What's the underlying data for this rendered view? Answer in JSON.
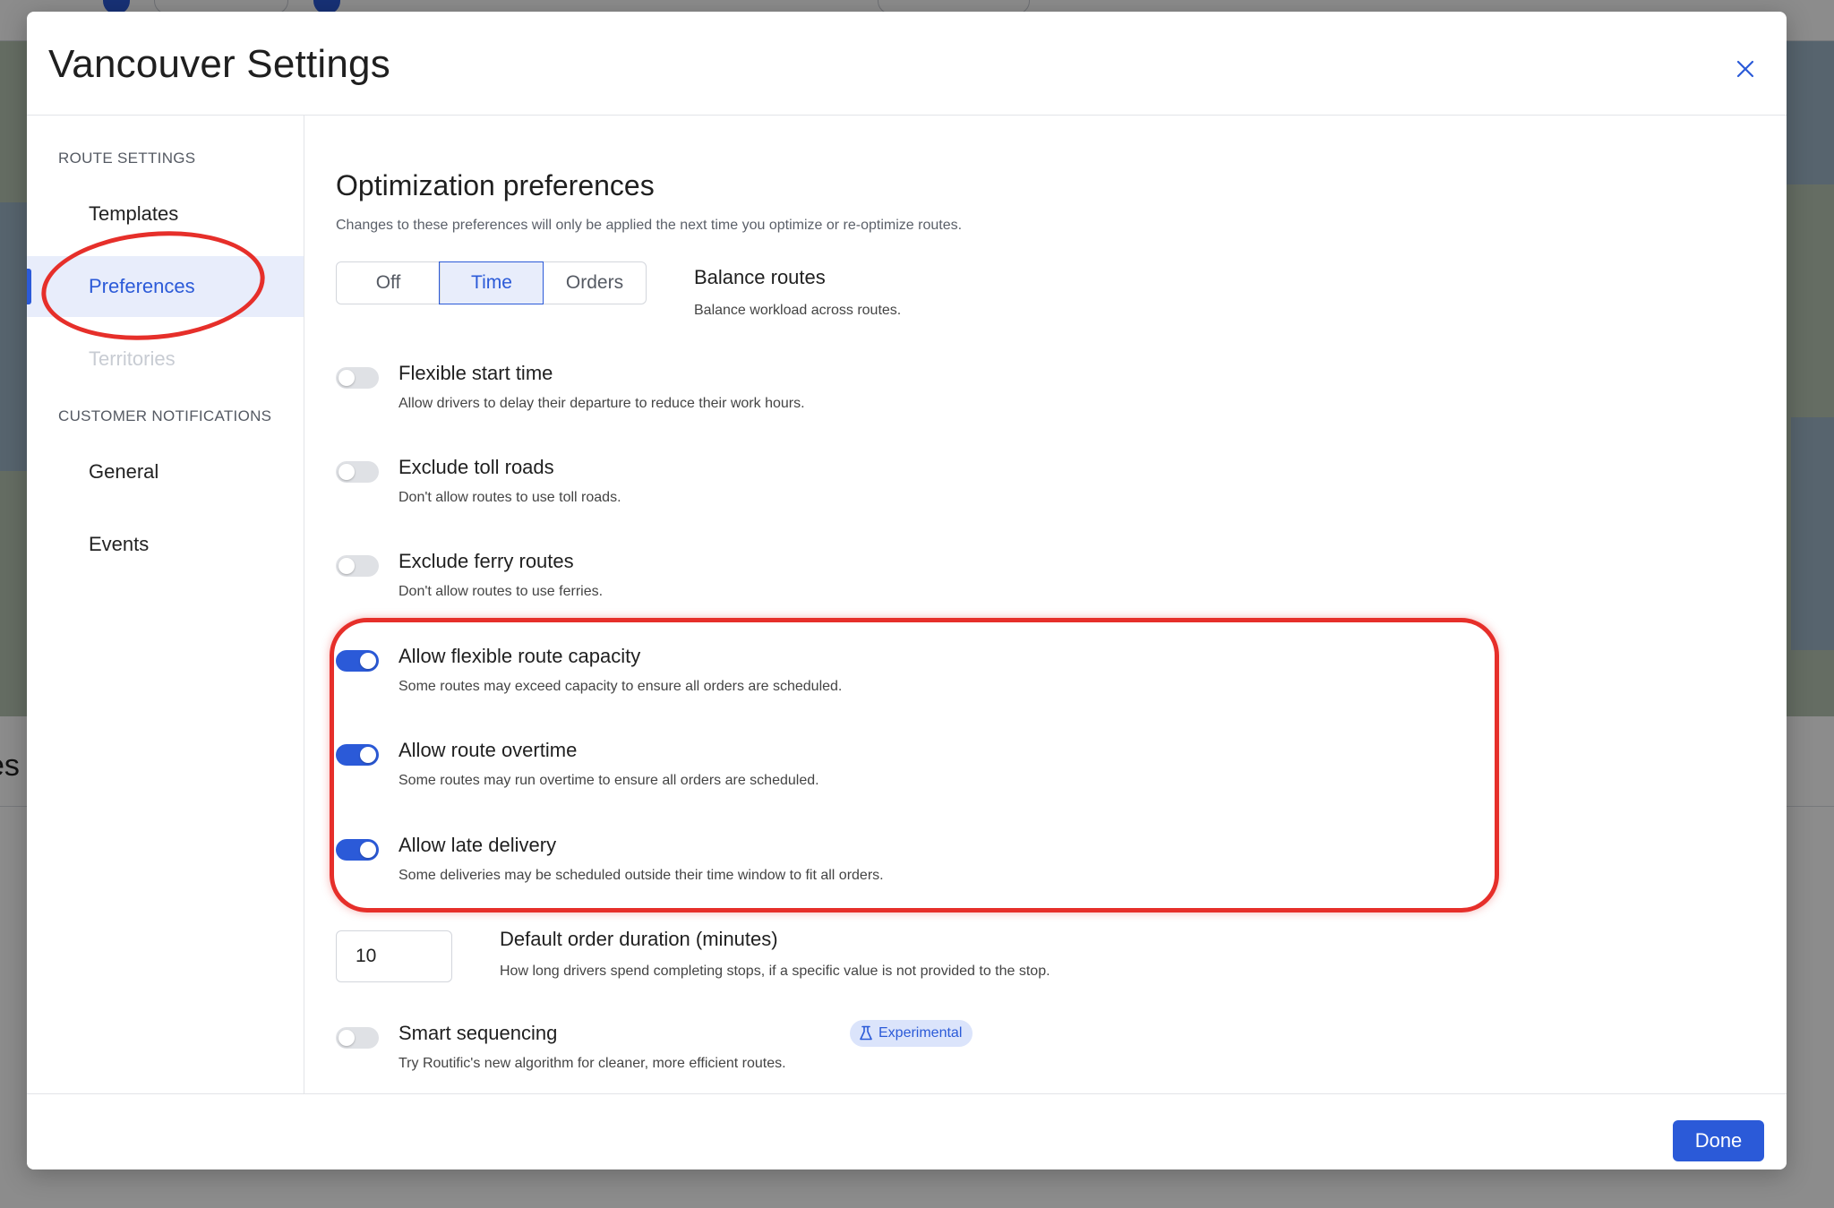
{
  "modal": {
    "title": "Vancouver Settings",
    "done_label": "Done"
  },
  "sidebar": {
    "route_section": "ROUTE SETTINGS",
    "route_items": [
      {
        "label": "Templates"
      },
      {
        "label": "Preferences"
      },
      {
        "label": "Territories"
      }
    ],
    "notifications_section": "CUSTOMER NOTIFICATIONS",
    "notification_items": [
      {
        "label": "General"
      },
      {
        "label": "Events"
      }
    ]
  },
  "content": {
    "title": "Optimization preferences",
    "subtitle": "Changes to these preferences will only be applied the next time you optimize or re-optimize routes.",
    "balance": {
      "options": [
        "Off",
        "Time",
        "Orders"
      ],
      "selected": "Time",
      "label": "Balance routes",
      "description": "Balance workload across routes."
    },
    "toggles": [
      {
        "label": "Flexible start time",
        "description": "Allow drivers to delay their departure to reduce their work hours.",
        "enabled": false
      },
      {
        "label": "Exclude toll roads",
        "description": "Don't allow routes to use toll roads.",
        "enabled": false
      },
      {
        "label": "Exclude ferry routes",
        "description": "Don't allow routes to use ferries.",
        "enabled": false
      },
      {
        "label": "Allow flexible route capacity",
        "description": "Some routes may exceed capacity to ensure all orders are scheduled.",
        "enabled": true
      },
      {
        "label": "Allow route overtime",
        "description": "Some routes may run overtime to ensure all orders are scheduled.",
        "enabled": true
      },
      {
        "label": "Allow late delivery",
        "description": "Some deliveries may be scheduled outside their time window to fit all orders.",
        "enabled": true
      }
    ],
    "order_duration": {
      "value": "10",
      "label": "Default order duration (minutes)",
      "description": "How long drivers spend completing stops, if a specific value is not provided to the stop."
    },
    "smart_sequencing": {
      "label": "Smart sequencing",
      "badge": "Experimental",
      "description": "Try Routific's new algorithm for cleaner, more efficient routes.",
      "enabled": false
    }
  },
  "background": {
    "lower_text": "es"
  },
  "colors": {
    "accent": "#2b5ad8",
    "annotation": "#e62f2a"
  }
}
